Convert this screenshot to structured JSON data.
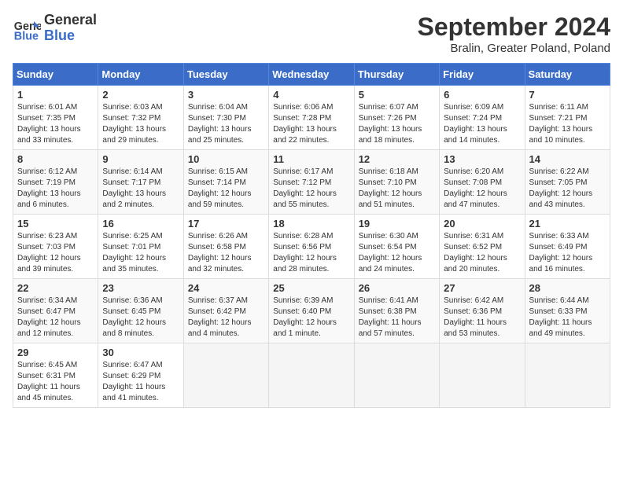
{
  "header": {
    "logo_line1": "General",
    "logo_line2": "Blue",
    "title": "September 2024",
    "subtitle": "Bralin, Greater Poland, Poland"
  },
  "weekdays": [
    "Sunday",
    "Monday",
    "Tuesday",
    "Wednesday",
    "Thursday",
    "Friday",
    "Saturday"
  ],
  "weeks": [
    [
      {
        "day": "1",
        "info": "Sunrise: 6:01 AM\nSunset: 7:35 PM\nDaylight: 13 hours\nand 33 minutes."
      },
      {
        "day": "2",
        "info": "Sunrise: 6:03 AM\nSunset: 7:32 PM\nDaylight: 13 hours\nand 29 minutes."
      },
      {
        "day": "3",
        "info": "Sunrise: 6:04 AM\nSunset: 7:30 PM\nDaylight: 13 hours\nand 25 minutes."
      },
      {
        "day": "4",
        "info": "Sunrise: 6:06 AM\nSunset: 7:28 PM\nDaylight: 13 hours\nand 22 minutes."
      },
      {
        "day": "5",
        "info": "Sunrise: 6:07 AM\nSunset: 7:26 PM\nDaylight: 13 hours\nand 18 minutes."
      },
      {
        "day": "6",
        "info": "Sunrise: 6:09 AM\nSunset: 7:24 PM\nDaylight: 13 hours\nand 14 minutes."
      },
      {
        "day": "7",
        "info": "Sunrise: 6:11 AM\nSunset: 7:21 PM\nDaylight: 13 hours\nand 10 minutes."
      }
    ],
    [
      {
        "day": "8",
        "info": "Sunrise: 6:12 AM\nSunset: 7:19 PM\nDaylight: 13 hours\nand 6 minutes."
      },
      {
        "day": "9",
        "info": "Sunrise: 6:14 AM\nSunset: 7:17 PM\nDaylight: 13 hours\nand 2 minutes."
      },
      {
        "day": "10",
        "info": "Sunrise: 6:15 AM\nSunset: 7:14 PM\nDaylight: 12 hours\nand 59 minutes."
      },
      {
        "day": "11",
        "info": "Sunrise: 6:17 AM\nSunset: 7:12 PM\nDaylight: 12 hours\nand 55 minutes."
      },
      {
        "day": "12",
        "info": "Sunrise: 6:18 AM\nSunset: 7:10 PM\nDaylight: 12 hours\nand 51 minutes."
      },
      {
        "day": "13",
        "info": "Sunrise: 6:20 AM\nSunset: 7:08 PM\nDaylight: 12 hours\nand 47 minutes."
      },
      {
        "day": "14",
        "info": "Sunrise: 6:22 AM\nSunset: 7:05 PM\nDaylight: 12 hours\nand 43 minutes."
      }
    ],
    [
      {
        "day": "15",
        "info": "Sunrise: 6:23 AM\nSunset: 7:03 PM\nDaylight: 12 hours\nand 39 minutes."
      },
      {
        "day": "16",
        "info": "Sunrise: 6:25 AM\nSunset: 7:01 PM\nDaylight: 12 hours\nand 35 minutes."
      },
      {
        "day": "17",
        "info": "Sunrise: 6:26 AM\nSunset: 6:58 PM\nDaylight: 12 hours\nand 32 minutes."
      },
      {
        "day": "18",
        "info": "Sunrise: 6:28 AM\nSunset: 6:56 PM\nDaylight: 12 hours\nand 28 minutes."
      },
      {
        "day": "19",
        "info": "Sunrise: 6:30 AM\nSunset: 6:54 PM\nDaylight: 12 hours\nand 24 minutes."
      },
      {
        "day": "20",
        "info": "Sunrise: 6:31 AM\nSunset: 6:52 PM\nDaylight: 12 hours\nand 20 minutes."
      },
      {
        "day": "21",
        "info": "Sunrise: 6:33 AM\nSunset: 6:49 PM\nDaylight: 12 hours\nand 16 minutes."
      }
    ],
    [
      {
        "day": "22",
        "info": "Sunrise: 6:34 AM\nSunset: 6:47 PM\nDaylight: 12 hours\nand 12 minutes."
      },
      {
        "day": "23",
        "info": "Sunrise: 6:36 AM\nSunset: 6:45 PM\nDaylight: 12 hours\nand 8 minutes."
      },
      {
        "day": "24",
        "info": "Sunrise: 6:37 AM\nSunset: 6:42 PM\nDaylight: 12 hours\nand 4 minutes."
      },
      {
        "day": "25",
        "info": "Sunrise: 6:39 AM\nSunset: 6:40 PM\nDaylight: 12 hours\nand 1 minute."
      },
      {
        "day": "26",
        "info": "Sunrise: 6:41 AM\nSunset: 6:38 PM\nDaylight: 11 hours\nand 57 minutes."
      },
      {
        "day": "27",
        "info": "Sunrise: 6:42 AM\nSunset: 6:36 PM\nDaylight: 11 hours\nand 53 minutes."
      },
      {
        "day": "28",
        "info": "Sunrise: 6:44 AM\nSunset: 6:33 PM\nDaylight: 11 hours\nand 49 minutes."
      }
    ],
    [
      {
        "day": "29",
        "info": "Sunrise: 6:45 AM\nSunset: 6:31 PM\nDaylight: 11 hours\nand 45 minutes."
      },
      {
        "day": "30",
        "info": "Sunrise: 6:47 AM\nSunset: 6:29 PM\nDaylight: 11 hours\nand 41 minutes."
      },
      {
        "day": "",
        "info": ""
      },
      {
        "day": "",
        "info": ""
      },
      {
        "day": "",
        "info": ""
      },
      {
        "day": "",
        "info": ""
      },
      {
        "day": "",
        "info": ""
      }
    ]
  ]
}
